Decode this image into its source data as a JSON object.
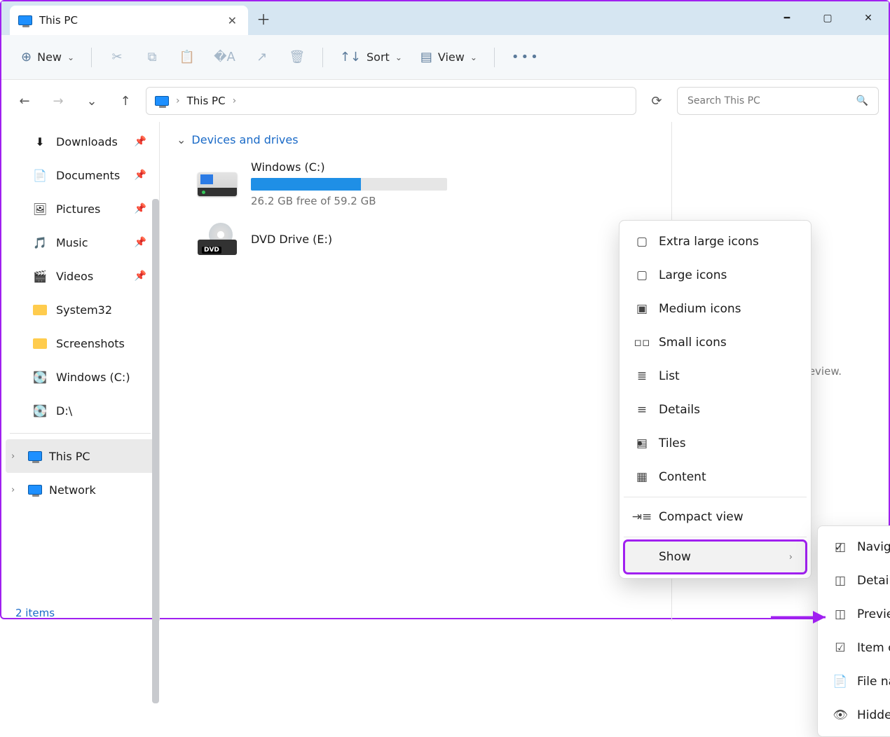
{
  "window": {
    "tab_title": "This PC"
  },
  "toolbar": {
    "new_label": "New",
    "sort_label": "Sort",
    "view_label": "View"
  },
  "address": {
    "crumb": "This PC",
    "search_placeholder": "Search This PC"
  },
  "sidebar": {
    "quick": [
      {
        "label": "Downloads",
        "icon": "download"
      },
      {
        "label": "Documents",
        "icon": "doc"
      },
      {
        "label": "Pictures",
        "icon": "pic"
      },
      {
        "label": "Music",
        "icon": "music"
      },
      {
        "label": "Videos",
        "icon": "video"
      },
      {
        "label": "System32",
        "icon": "folder"
      },
      {
        "label": "Screenshots",
        "icon": "folder"
      },
      {
        "label": "Windows (C:)",
        "icon": "drive"
      },
      {
        "label": "D:\\",
        "icon": "drive2"
      }
    ],
    "tree": [
      {
        "label": "This PC",
        "selected": true
      },
      {
        "label": "Network",
        "selected": false
      }
    ]
  },
  "content": {
    "group_header": "Devices and drives",
    "drives": [
      {
        "label": "Windows (C:)",
        "sub": "26.2 GB free of 59.2 GB",
        "fill_pct": 56,
        "type": "win"
      },
      {
        "label": "DVD Drive (E:)",
        "sub": "",
        "type": "dvd"
      }
    ]
  },
  "preview": {
    "empty_text": "Select a file to preview."
  },
  "view_menu": {
    "items": [
      {
        "label": "Extra large icons",
        "icon": "xl"
      },
      {
        "label": "Large icons",
        "icon": "lg"
      },
      {
        "label": "Medium icons",
        "icon": "md"
      },
      {
        "label": "Small icons",
        "icon": "sm"
      },
      {
        "label": "List",
        "icon": "list"
      },
      {
        "label": "Details",
        "icon": "details"
      },
      {
        "label": "Tiles",
        "icon": "tiles",
        "checked": true
      },
      {
        "label": "Content",
        "icon": "content"
      }
    ],
    "compact_label": "Compact view",
    "show_label": "Show"
  },
  "show_submenu": {
    "items": [
      {
        "label": "Navigation pane",
        "checked": true
      },
      {
        "label": "Details pane"
      },
      {
        "label": "Preview pane"
      },
      {
        "label": "Item check boxes"
      },
      {
        "label": "File name extensions"
      },
      {
        "label": "Hidden items"
      }
    ]
  },
  "status": {
    "text": "2 items"
  }
}
